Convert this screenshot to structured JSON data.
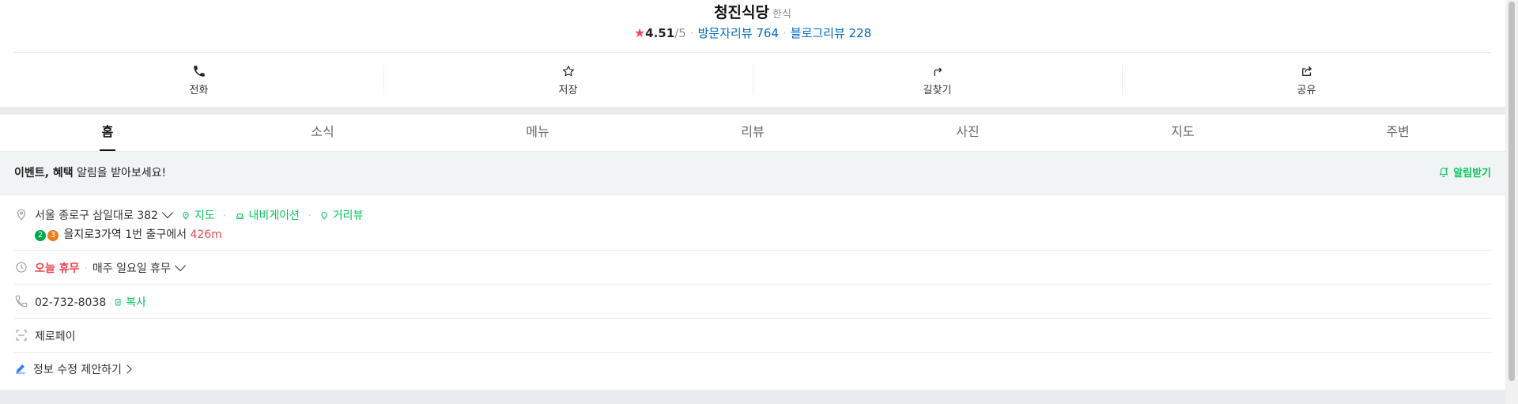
{
  "header": {
    "title": "청진식당",
    "category": "한식",
    "rating_star": "★",
    "rating_score": "4.51",
    "rating_outof": "/5",
    "visitor_reviews": "방문자리뷰 764",
    "blog_reviews": "블로그리뷰 228"
  },
  "actions": [
    {
      "label": "전화",
      "icon": "phone-icon"
    },
    {
      "label": "저장",
      "icon": "star-outline-icon"
    },
    {
      "label": "길찾기",
      "icon": "directions-icon"
    },
    {
      "label": "공유",
      "icon": "share-icon"
    }
  ],
  "tabs": [
    {
      "label": "홈",
      "active": true
    },
    {
      "label": "소식",
      "active": false
    },
    {
      "label": "메뉴",
      "active": false
    },
    {
      "label": "리뷰",
      "active": false
    },
    {
      "label": "사진",
      "active": false
    },
    {
      "label": "지도",
      "active": false
    },
    {
      "label": "주변",
      "active": false
    }
  ],
  "notice": {
    "bold_text": "이벤트, 혜택",
    "text": " 알림을 받아보세요!",
    "button": "알림받기"
  },
  "address": {
    "text": "서울 종로구 삼일대로 382",
    "map_link": "지도",
    "nav_link": "내비게이션",
    "street_link": "거리뷰",
    "line2": {
      "badge_2": "2",
      "badge_3": "3",
      "station": "을지로3가역",
      "exit_text": " 1번 출구에서 ",
      "distance": "426m"
    }
  },
  "hours": {
    "status": "오늘 휴무",
    "detail": "매주 일요일 휴무"
  },
  "phone": {
    "number": "02-732-8038",
    "copy": "복사"
  },
  "payment": {
    "text": "제로페이"
  },
  "edit_suggest": {
    "text": "정보 수정 제안하기"
  },
  "colors": {
    "accent_green": "#03c75a",
    "review_blue": "#0068c3",
    "star_red": "#f5475c",
    "closed_red": "#f0424b"
  }
}
